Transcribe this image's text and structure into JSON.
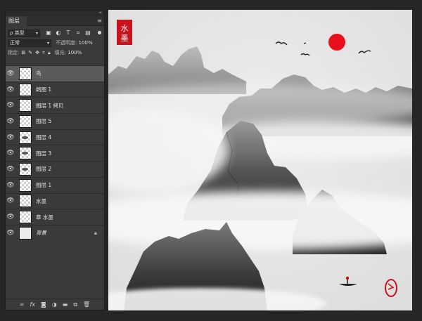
{
  "panel": {
    "tab_label": "图层",
    "collapse_glyph": "‹‹",
    "menu_glyph": "≡",
    "filter": {
      "label": "ρ 类型",
      "icons": [
        "image-filter-icon",
        "adjustment-filter-icon",
        "type-filter-icon",
        "shape-filter-icon",
        "smart-object-filter-icon"
      ]
    },
    "blend": {
      "mode": "正常",
      "opacity_label": "不透明度:",
      "opacity_value": "100%"
    },
    "lock": {
      "label": "锁定:",
      "fill_label": "填充:",
      "fill_value": "100%"
    }
  },
  "layers": [
    {
      "name": "鸟",
      "selected": true,
      "thumb": "transparent"
    },
    {
      "name": "鹈图 1",
      "selected": false,
      "thumb": "transparent"
    },
    {
      "name": "图层 1 拷贝",
      "selected": false,
      "thumb": "transparent"
    },
    {
      "name": "图层 5",
      "selected": false,
      "thumb": "transparent"
    },
    {
      "name": "图层 4",
      "selected": false,
      "thumb": "transparent"
    },
    {
      "name": "图层 3",
      "selected": false,
      "thumb": "transparent"
    },
    {
      "name": "图层 2",
      "selected": false,
      "thumb": "transparent"
    },
    {
      "name": "图层 1",
      "selected": false,
      "thumb": "transparent"
    },
    {
      "name": "水墨",
      "selected": false,
      "thumb": "transparent"
    },
    {
      "name": "章 水墨",
      "selected": false,
      "thumb": "transparent"
    },
    {
      "name": "背景",
      "selected": false,
      "thumb": "solid",
      "locked": true
    }
  ],
  "bottom_bar": [
    "link-icon",
    "fx-icon",
    "mask-icon",
    "adjustment-icon",
    "folder-icon",
    "new-layer-icon",
    "trash-icon"
  ],
  "canvas": {
    "seal_text": "水墨",
    "colors": {
      "sun": "#e8101a",
      "seal": "#c8141c",
      "mist": "#f4f4f4",
      "rock": "#3c3c3c"
    }
  }
}
